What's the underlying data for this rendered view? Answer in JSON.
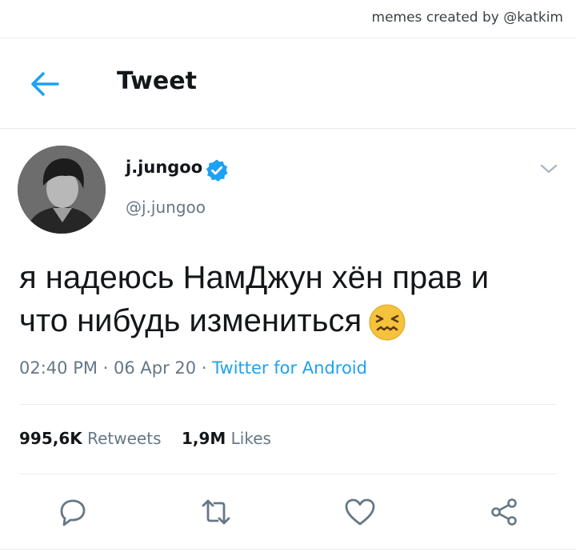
{
  "credit": "memes created by @katkim",
  "header": {
    "title": "Tweet"
  },
  "author": {
    "name": "j.jungoo",
    "handle": "@j.jungoo",
    "verified": true
  },
  "tweet": {
    "line1": "я надеюсь НамДжун хён прав и",
    "line2": "что нибудь измениться",
    "emoji": "confounded-face"
  },
  "meta": {
    "time": "02:40 PM",
    "sep1": " · ",
    "date": "06 Apr 20",
    "sep2": " · ",
    "source": "Twitter for Android"
  },
  "stats": {
    "retweets_count": "995,6K",
    "retweets_label": "Retweets",
    "likes_count": "1,9M",
    "likes_label": "Likes"
  },
  "colors": {
    "accent": "#1da1f2",
    "muted": "#657786",
    "text": "#14171a",
    "divider": "#e6ecf0"
  }
}
